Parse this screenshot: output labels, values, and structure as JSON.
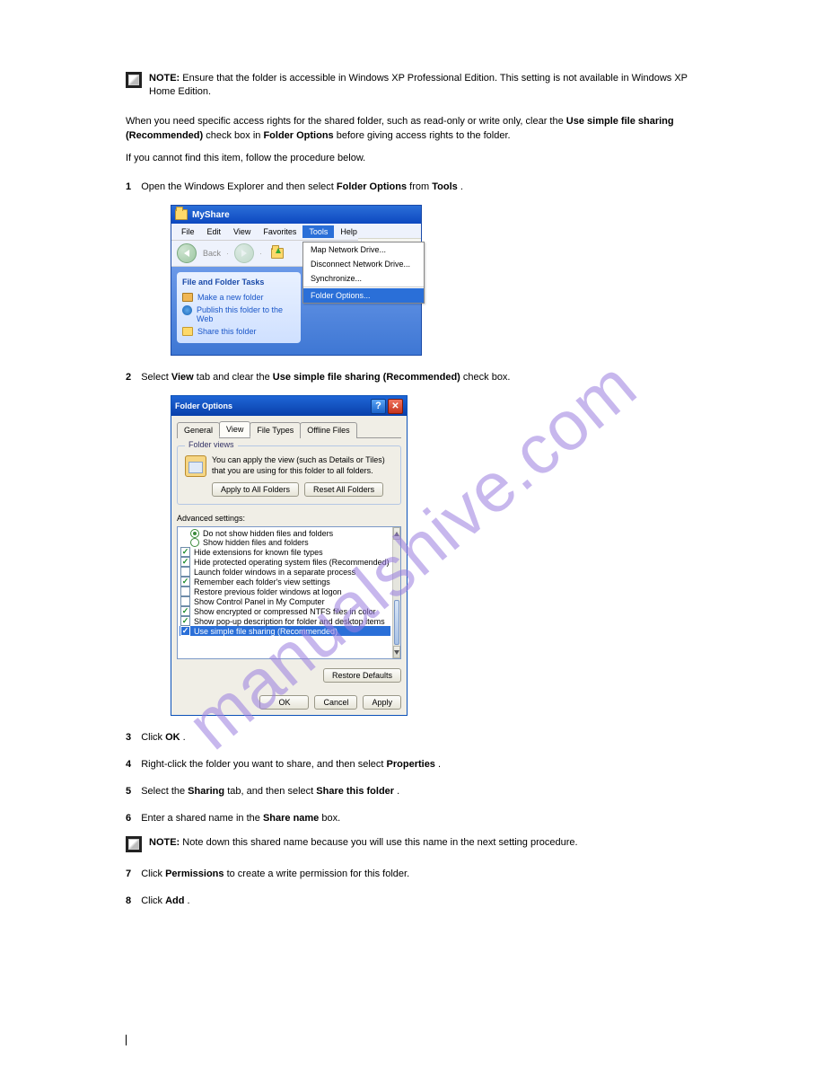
{
  "note1": {
    "label": "NOTE:",
    "text": "Ensure that the folder is accessible in Windows XP Professional Edition. This setting is not available in Windows XP Home Edition."
  },
  "intro1": "When you need specific access rights for the shared folder, such as read-only or write only, clear the",
  "intro1b": "Use simple file sharing (Recommended)",
  "intro1c": " check box in ",
  "intro1d": "Folder Options",
  "intro1e": " before giving access rights to the folder.",
  "intro2": "If you cannot find this item, follow the procedure below.",
  "step1": {
    "num": "1",
    "text": "Open the Windows Explorer and then select ",
    "bold1": "Folder Options",
    "text2": " from ",
    "bold2": "Tools",
    "text3": "."
  },
  "win1": {
    "title": "MyShare",
    "menu": [
      "File",
      "Edit",
      "View",
      "Favorites",
      "Tools",
      "Help"
    ],
    "back": "Back",
    "taskpanel_title": "File and Folder Tasks",
    "tasks": [
      "Make a new folder",
      "Publish this folder to the Web",
      "Share this folder"
    ],
    "dropdown": [
      "Map Network Drive...",
      "Disconnect Network Drive...",
      "Synchronize...",
      "Folder Options..."
    ]
  },
  "step2": {
    "num": "2",
    "text": "Select ",
    "bold1": "View",
    "text2": " tab and clear the ",
    "bold2": "Use simple file sharing (Recommended)",
    "text3": " check box."
  },
  "dlg": {
    "title": "Folder Options",
    "tabs": [
      "General",
      "View",
      "File Types",
      "Offline Files"
    ],
    "group_legend": "Folder views",
    "fv_text": "You can apply the view (such as Details or Tiles) that you are using for this folder to all folders.",
    "fv_btn1": "Apply to All Folders",
    "fv_btn2": "Reset All Folders",
    "adv_label": "Advanced settings:",
    "items": [
      {
        "type": "radio",
        "checked": true,
        "label": "Do not show hidden files and folders"
      },
      {
        "type": "radio",
        "checked": false,
        "label": "Show hidden files and folders"
      },
      {
        "type": "check",
        "checked": true,
        "label": "Hide extensions for known file types"
      },
      {
        "type": "check",
        "checked": true,
        "label": "Hide protected operating system files (Recommended)"
      },
      {
        "type": "check",
        "checked": false,
        "label": "Launch folder windows in a separate process"
      },
      {
        "type": "check",
        "checked": true,
        "label": "Remember each folder's view settings"
      },
      {
        "type": "check",
        "checked": false,
        "label": "Restore previous folder windows at logon"
      },
      {
        "type": "check",
        "checked": false,
        "label": "Show Control Panel in My Computer"
      },
      {
        "type": "check",
        "checked": true,
        "label": "Show encrypted or compressed NTFS files in color"
      },
      {
        "type": "check",
        "checked": true,
        "label": "Show pop-up description for folder and desktop items"
      },
      {
        "type": "check",
        "checked": true,
        "label": "Use simple file sharing (Recommended)",
        "selected": true
      }
    ],
    "restore": "Restore Defaults",
    "btn_ok": "OK",
    "btn_cancel": "Cancel",
    "btn_apply": "Apply"
  },
  "step3": {
    "num": "3",
    "text": "Click ",
    "bold1": "OK",
    "text2": "."
  },
  "step4": {
    "num": "4",
    "text": "Right-click the folder you want to share, and then select ",
    "bold1": "Properties",
    "text2": "."
  },
  "step5": {
    "num": "5",
    "text": "Select the ",
    "bold1": "Sharing",
    "text2": " tab, and then select ",
    "bold2": "Share this folder",
    "text3": "."
  },
  "step6": {
    "num": "6",
    "text": "Enter a shared name in the ",
    "bold1": "Share name",
    "text2": " box."
  },
  "note2": {
    "label": "NOTE:",
    "text": "Note down this shared name because you will use this name in the next setting procedure."
  },
  "step7": {
    "num": "7",
    "text": "Click ",
    "bold1": "Permissions",
    "text2": " to create a write permission for this folder."
  },
  "step8": {
    "num": "8",
    "text": "Click ",
    "bold1": "Add",
    "text2": "."
  },
  "watermark": "manualshive.com"
}
